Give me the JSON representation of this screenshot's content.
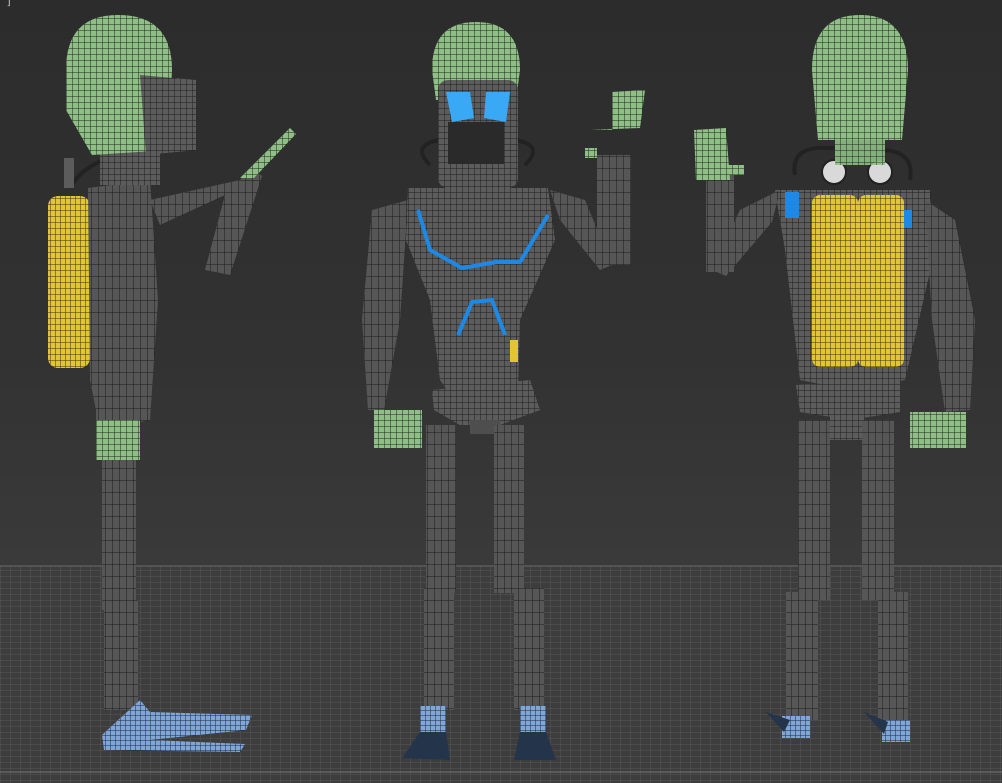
{
  "viewport": {
    "corner_label": " ]",
    "view_name": "front-side-back-orthographic",
    "colors": {
      "background_top": "#2c2c2c",
      "background_bottom": "#444444",
      "grid_line": "#5a5a5a",
      "mesh_body": "#5c5c5c",
      "mesh_wire": "#1e1e1e",
      "skin": "#8fbf86",
      "tank": "#e0c534",
      "accent_blue": "#1e88e5",
      "goggle_blue": "#3aa9f5",
      "fin": "#7fa6d6"
    }
  },
  "models": [
    {
      "name": "side-view",
      "icon": "diver-side-model"
    },
    {
      "name": "front-view",
      "icon": "diver-front-model"
    },
    {
      "name": "back-view",
      "icon": "diver-back-model"
    }
  ]
}
